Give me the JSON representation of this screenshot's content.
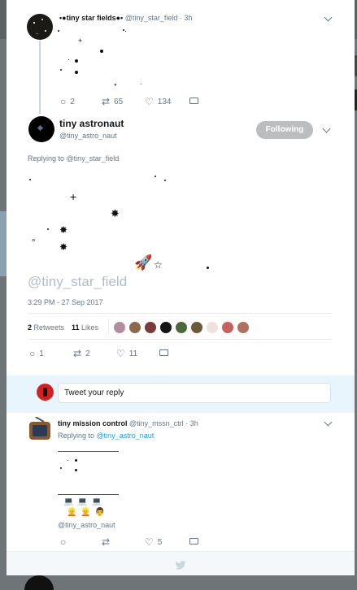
{
  "tweet1": {
    "name": "•●tiny star fields●•",
    "handle": "@tiny_star_field",
    "time": "3h",
    "stars": [
      "+",
      "⋆"
    ],
    "reply_count": "2",
    "retweet_count": "65",
    "like_count": "134"
  },
  "main": {
    "name": "tiny astronaut",
    "handle": "@tiny_astro_naut",
    "follow_label": "Following",
    "replying_prefix": "Replying to",
    "replying_handle": "@tiny_star_field",
    "stars": [
      "+",
      "✸",
      "✸",
      "✸",
      "∘",
      "🚀",
      "☆"
    ],
    "quoted_handle": "@tiny_star_field",
    "timestamp": "3:29 PM - 27 Sep 2017",
    "retweets_num": "2",
    "retweets_label": "Retweets",
    "likes_num": "11",
    "likes_label": "Likes",
    "reply_count": "1",
    "retweet_count": "2",
    "like_count": "11"
  },
  "reply_box": {
    "placeholder": "Tweet your reply"
  },
  "tweet3": {
    "name": "tiny mission control",
    "handle": "@tiny_mssn_ctrl",
    "time": "3h",
    "replying_prefix": "Replying to",
    "replying_handle": "@tiny_astro_naut",
    "monitors": "💻 💻 💻",
    "people": "👱 👱 👨",
    "mention": "@tiny_astro_naut",
    "like_count": "5"
  },
  "colors": {
    "accent": "#1da1f2",
    "follow_button": "#bbbdbf",
    "reply_bar": "#e8f5fd",
    "muted": "#657786"
  },
  "icons": [
    "chevron-down-icon",
    "reply-icon",
    "retweet-icon",
    "like-icon",
    "message-icon",
    "twitter-bird-icon"
  ]
}
